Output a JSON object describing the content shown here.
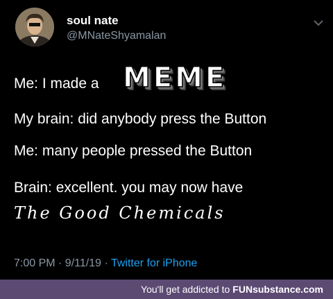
{
  "tweet": {
    "author": {
      "display_name": "soul nate",
      "handle": "@MNateShyamalan"
    },
    "lines": [
      "Me: I made a",
      "My brain: did anybody press the Button",
      "Me: many people pressed the Button",
      "Brain: excellent. you may now have"
    ],
    "meme_word": "MEME",
    "chemicals": "The Good Chemicals",
    "meta": {
      "time_date": "7:00 PM · 9/11/19 ·",
      "source": "Twitter for iPhone"
    }
  },
  "watermark": {
    "text": "You'll get addicted to",
    "brand_fun": "FUN",
    "brand_rest": "substance.com"
  },
  "colors": {
    "background": "#000000",
    "secondary_text": "#8b98a5",
    "link": "#1da1f2",
    "footer_bg": "#5c4a73"
  },
  "icons": {
    "chevron": "chevron-down-icon"
  }
}
